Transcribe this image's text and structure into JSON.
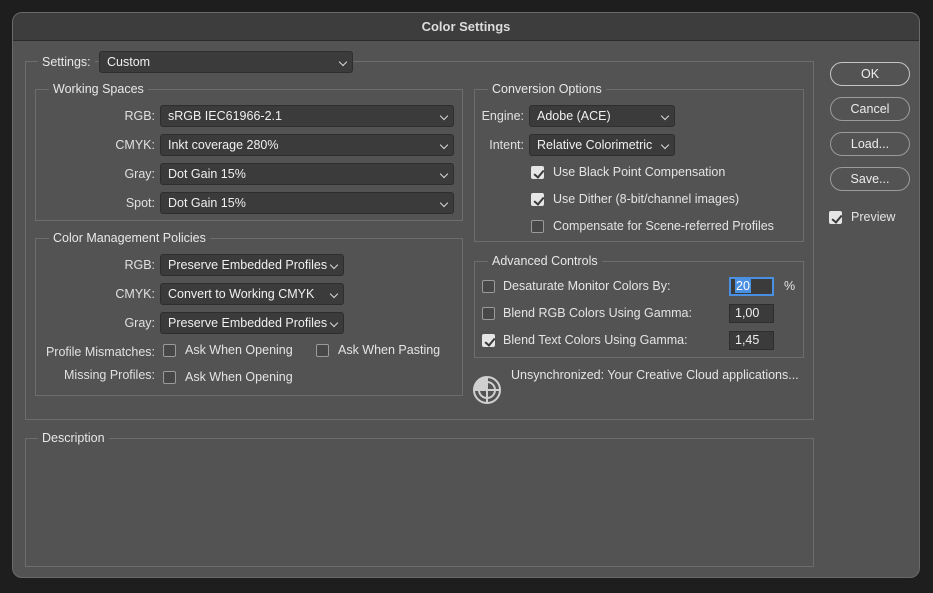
{
  "window": {
    "title": "Color Settings"
  },
  "settings": {
    "label": "Settings:",
    "value": "Custom"
  },
  "working_spaces": {
    "title": "Working Spaces",
    "rgb": {
      "label": "RGB:",
      "value": "sRGB IEC61966-2.1"
    },
    "cmyk": {
      "label": "CMYK:",
      "value": "Inkt coverage 280%"
    },
    "gray": {
      "label": "Gray:",
      "value": "Dot Gain 15%"
    },
    "spot": {
      "label": "Spot:",
      "value": "Dot Gain 15%"
    }
  },
  "policies": {
    "title": "Color Management Policies",
    "rgb": {
      "label": "RGB:",
      "value": "Preserve Embedded Profiles"
    },
    "cmyk": {
      "label": "CMYK:",
      "value": "Convert to Working CMYK"
    },
    "gray": {
      "label": "Gray:",
      "value": "Preserve Embedded Profiles"
    },
    "mismatch_label": "Profile Mismatches:",
    "mismatch_opening": "Ask When Opening",
    "mismatch_pasting": "Ask When Pasting",
    "missing_label": "Missing Profiles:",
    "missing_opening": "Ask When Opening"
  },
  "conversion": {
    "title": "Conversion Options",
    "engine": {
      "label": "Engine:",
      "value": "Adobe (ACE)"
    },
    "intent": {
      "label": "Intent:",
      "value": "Relative Colorimetric"
    },
    "black_point": "Use Black Point Compensation",
    "dither": "Use Dither (8-bit/channel images)",
    "scene": "Compensate for Scene-referred Profiles"
  },
  "advanced": {
    "title": "Advanced Controls",
    "desaturate": {
      "label": "Desaturate Monitor Colors By:",
      "value": "20",
      "unit": "%"
    },
    "blend_rgb": {
      "label": "Blend RGB Colors Using Gamma:",
      "value": "1,00"
    },
    "blend_text": {
      "label": "Blend Text Colors Using Gamma:",
      "value": "1,45"
    }
  },
  "sync": {
    "text": "Unsynchronized: Your Creative Cloud applications..."
  },
  "description": {
    "title": "Description"
  },
  "buttons": {
    "ok": "OK",
    "cancel": "Cancel",
    "load": "Load...",
    "save": "Save..."
  },
  "preview": {
    "label": "Preview"
  }
}
